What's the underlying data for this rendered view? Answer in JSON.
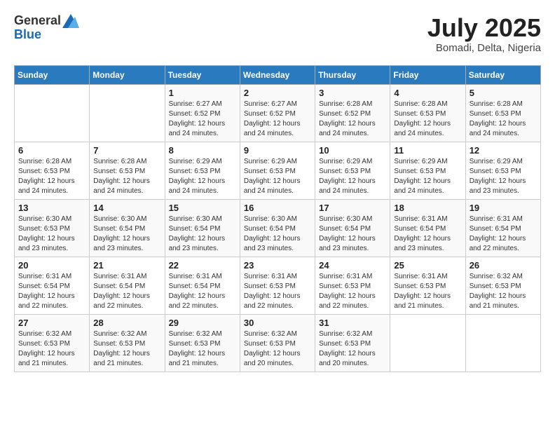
{
  "header": {
    "logo_general": "General",
    "logo_blue": "Blue",
    "month_title": "July 2025",
    "location": "Bomadi, Delta, Nigeria"
  },
  "days_of_week": [
    "Sunday",
    "Monday",
    "Tuesday",
    "Wednesday",
    "Thursday",
    "Friday",
    "Saturday"
  ],
  "weeks": [
    [
      {
        "day": "",
        "info": ""
      },
      {
        "day": "",
        "info": ""
      },
      {
        "day": "1",
        "info": "Sunrise: 6:27 AM\nSunset: 6:52 PM\nDaylight: 12 hours and 24 minutes."
      },
      {
        "day": "2",
        "info": "Sunrise: 6:27 AM\nSunset: 6:52 PM\nDaylight: 12 hours and 24 minutes."
      },
      {
        "day": "3",
        "info": "Sunrise: 6:28 AM\nSunset: 6:52 PM\nDaylight: 12 hours and 24 minutes."
      },
      {
        "day": "4",
        "info": "Sunrise: 6:28 AM\nSunset: 6:53 PM\nDaylight: 12 hours and 24 minutes."
      },
      {
        "day": "5",
        "info": "Sunrise: 6:28 AM\nSunset: 6:53 PM\nDaylight: 12 hours and 24 minutes."
      }
    ],
    [
      {
        "day": "6",
        "info": "Sunrise: 6:28 AM\nSunset: 6:53 PM\nDaylight: 12 hours and 24 minutes."
      },
      {
        "day": "7",
        "info": "Sunrise: 6:28 AM\nSunset: 6:53 PM\nDaylight: 12 hours and 24 minutes."
      },
      {
        "day": "8",
        "info": "Sunrise: 6:29 AM\nSunset: 6:53 PM\nDaylight: 12 hours and 24 minutes."
      },
      {
        "day": "9",
        "info": "Sunrise: 6:29 AM\nSunset: 6:53 PM\nDaylight: 12 hours and 24 minutes."
      },
      {
        "day": "10",
        "info": "Sunrise: 6:29 AM\nSunset: 6:53 PM\nDaylight: 12 hours and 24 minutes."
      },
      {
        "day": "11",
        "info": "Sunrise: 6:29 AM\nSunset: 6:53 PM\nDaylight: 12 hours and 24 minutes."
      },
      {
        "day": "12",
        "info": "Sunrise: 6:29 AM\nSunset: 6:53 PM\nDaylight: 12 hours and 23 minutes."
      }
    ],
    [
      {
        "day": "13",
        "info": "Sunrise: 6:30 AM\nSunset: 6:53 PM\nDaylight: 12 hours and 23 minutes."
      },
      {
        "day": "14",
        "info": "Sunrise: 6:30 AM\nSunset: 6:54 PM\nDaylight: 12 hours and 23 minutes."
      },
      {
        "day": "15",
        "info": "Sunrise: 6:30 AM\nSunset: 6:54 PM\nDaylight: 12 hours and 23 minutes."
      },
      {
        "day": "16",
        "info": "Sunrise: 6:30 AM\nSunset: 6:54 PM\nDaylight: 12 hours and 23 minutes."
      },
      {
        "day": "17",
        "info": "Sunrise: 6:30 AM\nSunset: 6:54 PM\nDaylight: 12 hours and 23 minutes."
      },
      {
        "day": "18",
        "info": "Sunrise: 6:31 AM\nSunset: 6:54 PM\nDaylight: 12 hours and 23 minutes."
      },
      {
        "day": "19",
        "info": "Sunrise: 6:31 AM\nSunset: 6:54 PM\nDaylight: 12 hours and 22 minutes."
      }
    ],
    [
      {
        "day": "20",
        "info": "Sunrise: 6:31 AM\nSunset: 6:54 PM\nDaylight: 12 hours and 22 minutes."
      },
      {
        "day": "21",
        "info": "Sunrise: 6:31 AM\nSunset: 6:54 PM\nDaylight: 12 hours and 22 minutes."
      },
      {
        "day": "22",
        "info": "Sunrise: 6:31 AM\nSunset: 6:54 PM\nDaylight: 12 hours and 22 minutes."
      },
      {
        "day": "23",
        "info": "Sunrise: 6:31 AM\nSunset: 6:53 PM\nDaylight: 12 hours and 22 minutes."
      },
      {
        "day": "24",
        "info": "Sunrise: 6:31 AM\nSunset: 6:53 PM\nDaylight: 12 hours and 22 minutes."
      },
      {
        "day": "25",
        "info": "Sunrise: 6:31 AM\nSunset: 6:53 PM\nDaylight: 12 hours and 21 minutes."
      },
      {
        "day": "26",
        "info": "Sunrise: 6:32 AM\nSunset: 6:53 PM\nDaylight: 12 hours and 21 minutes."
      }
    ],
    [
      {
        "day": "27",
        "info": "Sunrise: 6:32 AM\nSunset: 6:53 PM\nDaylight: 12 hours and 21 minutes."
      },
      {
        "day": "28",
        "info": "Sunrise: 6:32 AM\nSunset: 6:53 PM\nDaylight: 12 hours and 21 minutes."
      },
      {
        "day": "29",
        "info": "Sunrise: 6:32 AM\nSunset: 6:53 PM\nDaylight: 12 hours and 21 minutes."
      },
      {
        "day": "30",
        "info": "Sunrise: 6:32 AM\nSunset: 6:53 PM\nDaylight: 12 hours and 20 minutes."
      },
      {
        "day": "31",
        "info": "Sunrise: 6:32 AM\nSunset: 6:53 PM\nDaylight: 12 hours and 20 minutes."
      },
      {
        "day": "",
        "info": ""
      },
      {
        "day": "",
        "info": ""
      }
    ]
  ]
}
